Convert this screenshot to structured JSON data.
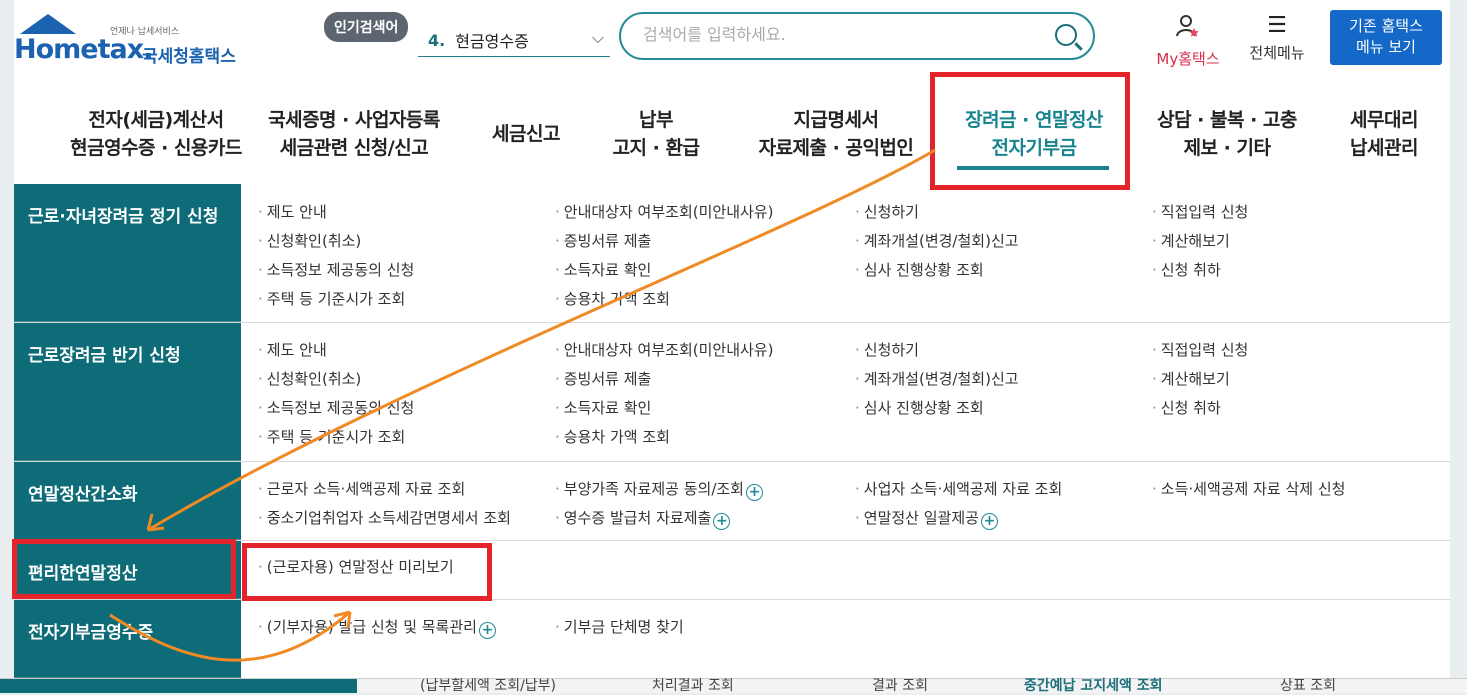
{
  "header": {
    "logo_small": "언제나 납세서비스",
    "logo_en": "Hometax.",
    "logo_ko": "국세청홈택스",
    "hot_badge": "인기검색어",
    "hot_num": "4.",
    "hot_value": "현금영수증",
    "search_placeholder": "검색어를 입력하세요.",
    "my_label": "My홈택스",
    "all_menu_label": "전체메뉴",
    "old_line1": "기존 홈택스",
    "old_line2": "메뉴 보기"
  },
  "nav": [
    {
      "l1": "전자(세금)계산서",
      "l2": "현금영수증 · 신용카드"
    },
    {
      "l1": "국세증명 · 사업자등록",
      "l2": "세금관련 신청/신고"
    },
    {
      "l1": "세금신고",
      "l2": ""
    },
    {
      "l1": "납부",
      "l2": "고지 · 환급"
    },
    {
      "l1": "지급명세서",
      "l2": "자료제출 · 공익법인"
    },
    {
      "l1": "장려금 · 연말정산",
      "l2": "전자기부금"
    },
    {
      "l1": "상담 · 불복 · 고충",
      "l2": "제보 · 기타"
    },
    {
      "l1": "세무대리",
      "l2": "납세관리"
    }
  ],
  "sections": [
    {
      "title": "근로·자녀장려금 정기 신청",
      "items": [
        "제도 안내",
        "안내대상자 여부조회(미안내사유)",
        "신청하기",
        "직접입력 신청",
        "신청확인(취소)",
        "증빙서류 제출",
        "계좌개설(변경/철회)신고",
        "계산해보기",
        "소득정보 제공동의 신청",
        "소득자료 확인",
        "심사 진행상황 조회",
        "신청 취하",
        "주택 등 기준시가 조회",
        "승용차 가액 조회"
      ]
    },
    {
      "title": "근로장려금 반기 신청",
      "items": [
        "제도 안내",
        "안내대상자 여부조회(미안내사유)",
        "신청하기",
        "직접입력 신청",
        "신청확인(취소)",
        "증빙서류 제출",
        "계좌개설(변경/철회)신고",
        "계산해보기",
        "소득정보 제공동의 신청",
        "소득자료 확인",
        "심사 진행상황 조회",
        "신청 취하",
        "주택 등 기준시가 조회",
        "승용차 가액 조회"
      ]
    },
    {
      "title": "연말정산간소화",
      "items": [
        "근로자 소득·세액공제 자료 조회",
        "부양가족 자료제공 동의/조회",
        "사업자 소득·세액공제 자료 조회",
        "소득·세액공제 자료 삭제 신청",
        "중소기업취업자 소득세감면명세서 조회",
        "영수증 발급처 자료제출",
        "연말정산 일괄제공"
      ]
    },
    {
      "title": "편리한연말정산",
      "items": [
        "(근로자용) 연말정산 미리보기"
      ]
    },
    {
      "title": "전자기부금영수증",
      "items": [
        "(기부자용) 발급 신청 및 목록관리",
        "기부금 단체명 찾기"
      ]
    }
  ],
  "bottom_tabs": [
    "(납부할세액 조회/납부)",
    "처리결과 조회",
    "결과 조회",
    "중간예납 고지세액 조회",
    "상표 조회"
  ]
}
